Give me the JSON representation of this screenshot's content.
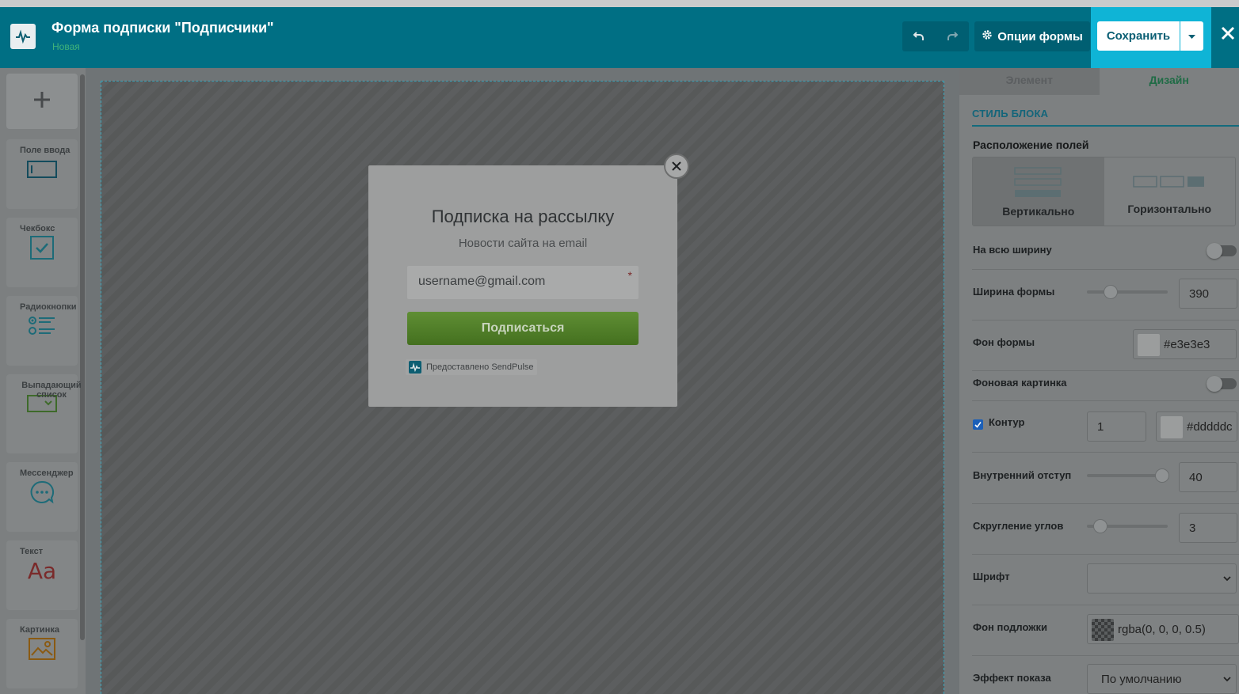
{
  "header": {
    "title": "Форма подписки \"Подписчики\"",
    "status": "Новая",
    "options_label": "Опции формы",
    "save_label": "Сохранить"
  },
  "sidebar": {
    "items": [
      {
        "label": "Поле ввода",
        "icon": "input-field-icon"
      },
      {
        "label": "Чекбокс",
        "icon": "checkbox-icon"
      },
      {
        "label": "Радиокнопки",
        "icon": "radio-buttons-icon"
      },
      {
        "label": "Выпадающий список",
        "icon": "dropdown-icon"
      },
      {
        "label": "Мессенджер",
        "icon": "messenger-icon"
      },
      {
        "label": "Текст",
        "icon": "text-icon"
      },
      {
        "label": "Картинка",
        "icon": "image-icon"
      }
    ],
    "text_icon_glyph": "Aa"
  },
  "popup": {
    "title": "Подписка на рассылку",
    "subtitle": "Новости сайта на email",
    "email_value": "username@gmail.com",
    "required_mark": "*",
    "button_label": "Подписаться",
    "branding": "Предоставлено SendPulse"
  },
  "panel": {
    "tabs": [
      "Элемент",
      "Дизайн"
    ],
    "active_tab": "Дизайн",
    "section": "СТИЛЬ БЛОКА",
    "layout_label": "Расположение полей",
    "layout_options": [
      "Вертикально",
      "Горизонтально"
    ],
    "full_width_label": "На всю ширину",
    "form_width_label": "Ширина формы",
    "form_width_value": "390",
    "form_bg_label": "Фон формы",
    "form_bg_value": "#e3e3e3",
    "bg_image_label": "Фоновая картинка",
    "border_label": "Контур",
    "border_width": "1",
    "border_color": "#dddddc",
    "padding_label": "Внутренний отступ",
    "padding_value": "40",
    "radius_label": "Скругление углов",
    "radius_value": "3",
    "font_label": "Шрифт",
    "font_value": "",
    "overlay_label": "Фон подложки",
    "overlay_value": "rgba(0, 0, 0, 0.5)",
    "effect_label": "Эффект показа",
    "effect_value": "По умолчанию"
  },
  "colors": {
    "header_bg": "#006f84",
    "save_highlight": "#0fb4d6",
    "submit_button": "#5f8e34",
    "accent_green": "#3fb37a"
  }
}
